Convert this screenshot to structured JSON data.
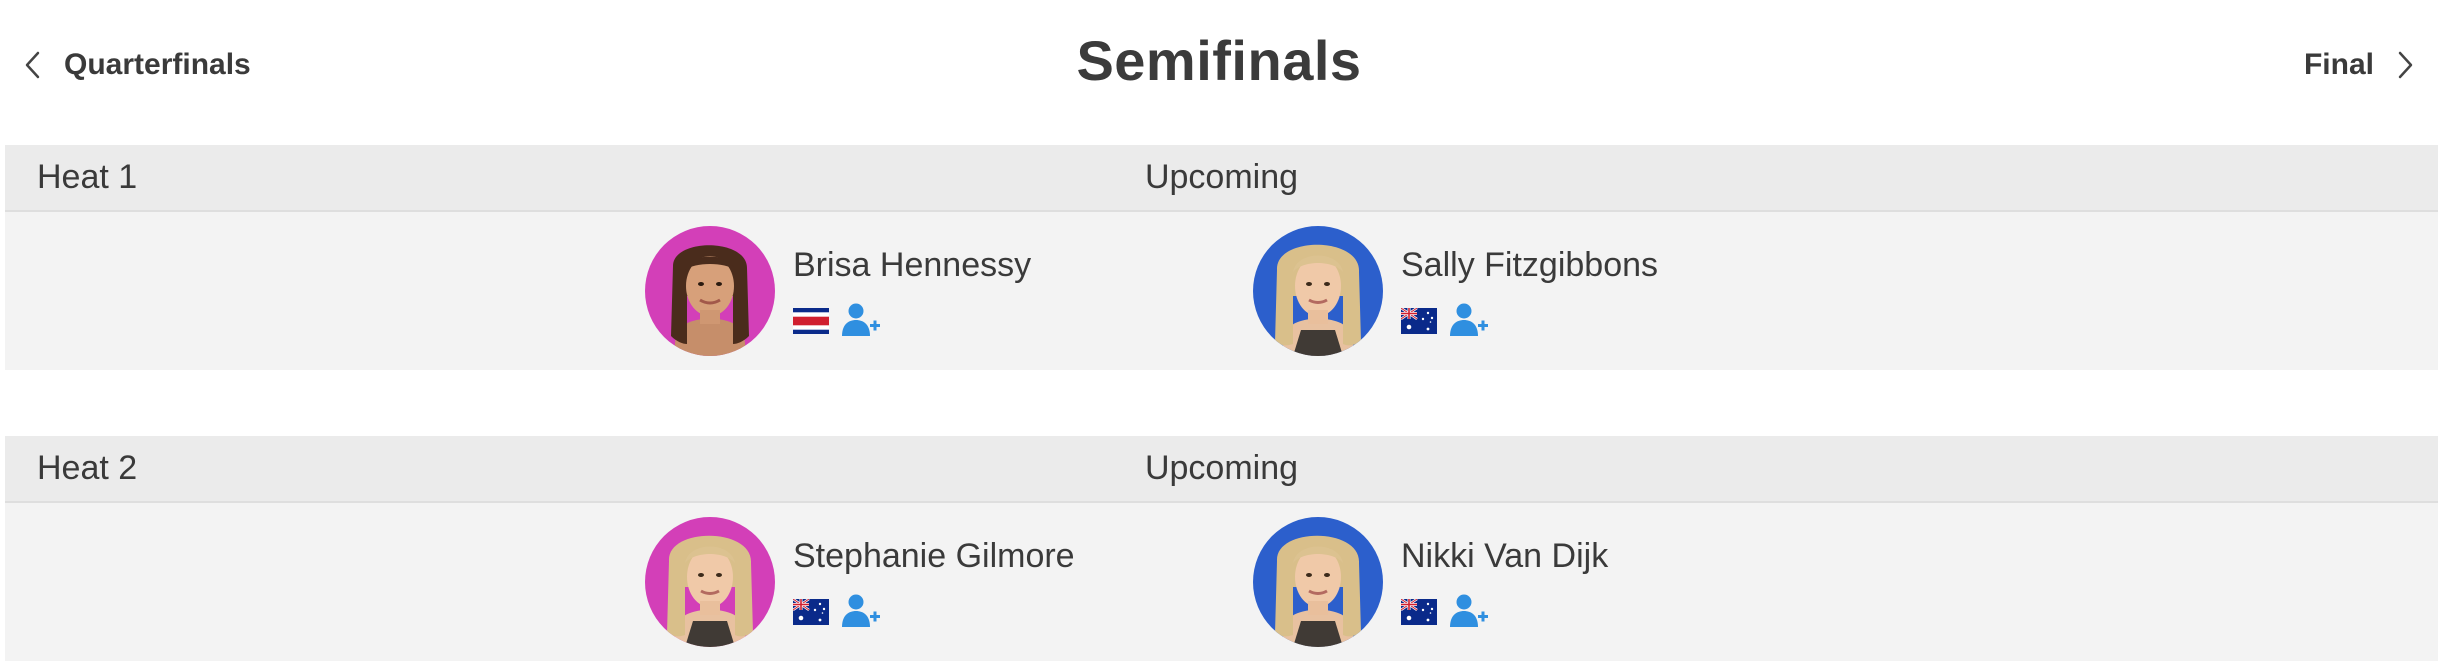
{
  "nav": {
    "prev_label": "Quarterfinals",
    "next_label": "Final",
    "title": "Semifinals"
  },
  "heats": [
    {
      "name": "Heat 1",
      "status": "Upcoming",
      "surfers": [
        {
          "name": "Brisa Hennessy",
          "flag": "costa-rica-flag",
          "jersey_color": "#d33fb8",
          "action_icon": "follow-athlete-icon"
        },
        {
          "name": "Sally Fitzgibbons",
          "flag": "australia-flag",
          "jersey_color": "#2c5fcc",
          "action_icon": "follow-athlete-icon"
        }
      ]
    },
    {
      "name": "Heat 2",
      "status": "Upcoming",
      "surfers": [
        {
          "name": "Stephanie Gilmore",
          "flag": "australia-flag",
          "jersey_color": "#d33fb8",
          "action_icon": "follow-athlete-icon"
        },
        {
          "name": "Nikki Van Dijk",
          "flag": "australia-flag",
          "jersey_color": "#2c5fcc",
          "action_icon": "follow-athlete-icon"
        }
      ]
    }
  ],
  "colors": {
    "accent_blue": "#2f8fe0",
    "header_bg": "#ebebeb",
    "row_bg": "#f3f3f3"
  }
}
